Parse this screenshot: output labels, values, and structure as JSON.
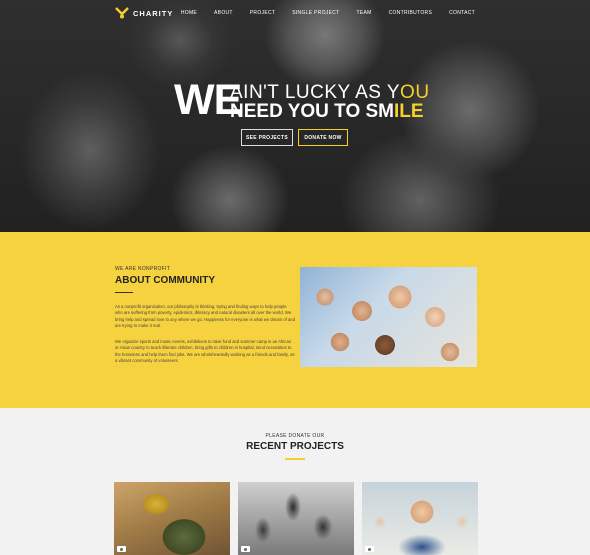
{
  "brand": {
    "name": "CHARITY",
    "accent": "#f5cf2c"
  },
  "nav": {
    "items": [
      "HOME",
      "ABOUT",
      "PROJECT",
      "SINGLE PROJECT",
      "TEAM",
      "CONTRIBUTORS",
      "CONTACT"
    ]
  },
  "hero": {
    "big": "WE",
    "line1_a": "AIN'T LUCKY AS Y",
    "line1_b": "OU",
    "line2_a": "NEED YOU TO SM",
    "line2_b": "ILE",
    "btn_projects": "SEE PROJECTS",
    "btn_donate": "DONATE NOW"
  },
  "about": {
    "kicker": "WE ARE NONPROFIT",
    "title": "ABOUT COMMUNITY",
    "p1": "As a nonprofit organization, our philosophy is thinking, trying and finding ways to help people who are suffering from poverty, epidemics, illiteracy and natural disasters all over the world. We bring help and spread love to any where we go. Happiness for everyone is what we dream of and are trying to make it real.",
    "p2": "We organize sports and music events, exhibitions to raise fund and summer camp in an African or Asian country to teach illiterate children, bring gifts to children in hospital, send necessities to the homeless and help them find jobs. We are wholeheartedly working as a friends and family, as a vibrant community of volunteers."
  },
  "projects": {
    "kicker": "PLEASE DONATE OUR",
    "title": "RECENT PROJECTS"
  }
}
